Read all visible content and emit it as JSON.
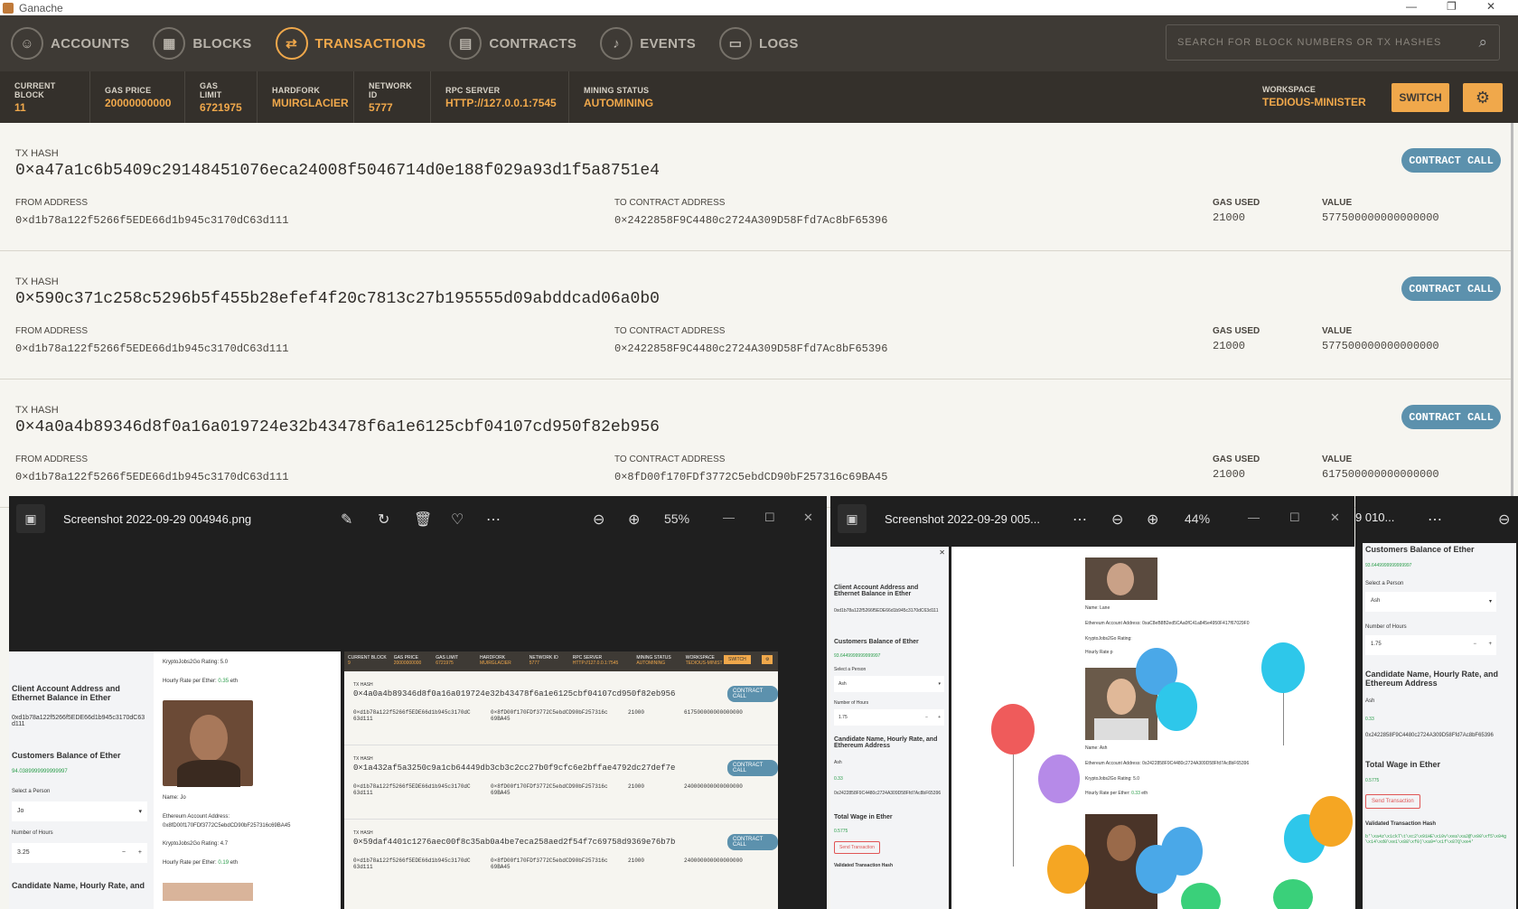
{
  "window": {
    "title": "Ganache",
    "minimize": "—",
    "maximize": "❐",
    "close": "✕"
  },
  "nav": {
    "accounts": "ACCOUNTS",
    "blocks": "BLOCKS",
    "transactions": "TRANSACTIONS",
    "contracts": "CONTRACTS",
    "events": "EVENTS",
    "logs": "LOGS",
    "search_placeholder": "SEARCH FOR BLOCK NUMBERS OR TX HASHES",
    "icons": [
      "person-icon",
      "grid-icon",
      "swap-arrows-icon",
      "document-icon",
      "bell-icon",
      "terminal-icon",
      "search-icon"
    ]
  },
  "stats": [
    {
      "label": "CURRENT BLOCK",
      "value": "11"
    },
    {
      "label": "GAS PRICE",
      "value": "20000000000"
    },
    {
      "label": "GAS LIMIT",
      "value": "6721975"
    },
    {
      "label": "HARDFORK",
      "value": "MUIRGLACIER"
    },
    {
      "label": "NETWORK ID",
      "value": "5777"
    },
    {
      "label": "RPC SERVER",
      "value": "HTTP://127.0.0.1:7545"
    },
    {
      "label": "MINING STATUS",
      "value": "AUTOMINING"
    }
  ],
  "workspace": {
    "label": "WORKSPACE",
    "value": "TEDIOUS-MINISTER",
    "switch": "SWITCH"
  },
  "labels": {
    "tx_hash": "TX HASH",
    "from": "FROM ADDRESS",
    "to": "TO CONTRACT ADDRESS",
    "gas": "GAS USED",
    "value": "VALUE",
    "call": "CONTRACT CALL"
  },
  "transactions": [
    {
      "hash": "0×a47a1c6b5409c29148451076eca24008f5046714d0e188f029a93d1f5a8751e4",
      "from": "0×d1b78a122f5266f5EDE66d1b945c3170dC63d111",
      "to": "0×2422858F9C4480c2724A309D58Ffd7Ac8bF65396",
      "gas": "21000",
      "value": "577500000000000000"
    },
    {
      "hash": "0×590c371c258c5296b5f455b28efef4f20c7813c27b195555d09abddcad06a0b0",
      "from": "0×d1b78a122f5266f5EDE66d1b945c3170dC63d111",
      "to": "0×2422858F9C4480c2724A309D58Ffd7Ac8bF65396",
      "gas": "21000",
      "value": "577500000000000000"
    },
    {
      "hash": "0×4a0a4b89346d8f0a16a019724e32b43478f6a1e6125cbf04107cd950f82eb956",
      "from": "0×d1b78a122f5266f5EDE66d1b945c3170dC63d111",
      "to": "0×8fD00f170FDf3772C5ebdCD90bF257316c69BA45",
      "gas": "21000",
      "value": "617500000000000000"
    }
  ],
  "viewer1": {
    "title": "Screenshot 2022-09-29 004946.png",
    "zoom": "55%",
    "left": {
      "heading1": "Client Account Address and Ethernet Balance in Ether",
      "addr": "0xd1b78a122f5266f5EDE66d1b945c3170dC63d111",
      "heading2": "Customers Balance of Ether",
      "balance": "94.0389999999999997",
      "select_label": "Select a Person",
      "select_value": "Jo",
      "hours_label": "Number of Hours",
      "hours_value": "3.25",
      "heading3": "Candidate Name, Hourly Rate, and"
    },
    "mid": {
      "rating1": "KryptoJobs2Go Rating: 5.0",
      "rate1": "Hourly Rate per Ether:",
      "rate1v": "0.35",
      "eth": "eth",
      "name": "Name: Jo",
      "acct": "Ethereum Account Address:",
      "acctv": "0x8fD00f170FDf3772C5ebdCD90bF257316c69BA45",
      "rating2": "KryptoJobs2Go Rating: 4.7",
      "rate2": "Hourly Rate per Ether:",
      "rate2v": "0.19"
    },
    "mini": {
      "stats": [
        {
          "l": "CURRENT BLOCK",
          "v": "9"
        },
        {
          "l": "GAS PRICE",
          "v": "20000000000"
        },
        {
          "l": "GAS LIMIT",
          "v": "6721975"
        },
        {
          "l": "HARDFORK",
          "v": "MUIRGLACIER"
        },
        {
          "l": "NETWORK ID",
          "v": "5777"
        },
        {
          "l": "RPC SERVER",
          "v": "HTTP://127.0.0.1:7545"
        },
        {
          "l": "MINING STATUS",
          "v": "AUTOMINING"
        },
        {
          "l": "WORKSPACE",
          "v": "TEDIOUS-MINIST"
        }
      ],
      "switch": "SWITCH",
      "txs": [
        {
          "hash": "0×4a0a4b89346d8f0a16a019724e32b43478f6a1e6125cbf04107cd950f82eb956",
          "from": "0×d1b78a122f5266f5EDE66d1b945c3170dC 63d111",
          "to": "0×8fD00f170FDf3772C5ebdCD90bF257316c 69BA45",
          "gas": "21000",
          "value": "617500000000000000"
        },
        {
          "hash": "0×1a432af5a3250c9a1cb64449db3cb3c2cc27b0f9cfc6e2bffae4792dc27def7e",
          "from": "0×d1b78a122f5266f5EDE66d1b945c3170dC 63d111",
          "to": "0×8fD00f170FDf3772C5ebdCD90bF257316c 69BA45",
          "gas": "21000",
          "value": "240000000000000000"
        },
        {
          "hash": "0×59daf4401c1276aec00f8c35ab0a4be7eca258aed2f54f7c69758d9369e76b7b",
          "from": "0×d1b78a122f5266f5EDE66d1b945c3170dC 63d111",
          "to": "0×8fD00f170FDf3772C5ebdCD90bF257316c 69BA45",
          "gas": "21000",
          "value": "240000000000000000"
        }
      ]
    }
  },
  "viewer2": {
    "title": "Screenshot 2022-09-29 005...",
    "zoom": "44%",
    "left": {
      "heading1": "Client Account Address and Ethernet Balance in Ether",
      "addr": "0xd1b78a122f5266f5EDE66d1b945c3170dC63d111",
      "heading2": "Customers Balance of Ether",
      "balance": "93.6449999999999997",
      "select_label": "Select a Person",
      "select_value": "Ash",
      "hours_label": "Number of Hours",
      "hours_value": "1.75",
      "heading3": "Candidate Name, Hourly Rate, and Ethereum Address",
      "name": "Ash",
      "rate": "0.33",
      "addr2": "0x2422858F9C4480c2724A309D58Ffd7Ac8bF65396",
      "heading4": "Total Wage in Ether",
      "wage": "0.5775",
      "send": "Send Transaction",
      "heading5": "Validated Transaction Hash"
    },
    "mid": {
      "name1": "Name: Lane",
      "acct1": "Ethereum Account Address: 0xaC8eB8B2ed5CAa0fC41a845e4950F417f67029F0",
      "rating1": "KryptoJobs2Go Rating:",
      "rate1": "Hourly Rate p",
      "name2": "Name: Ash",
      "acct2": "Ethereum Account Address: 0x2422858F9C4480c2724A309D58Ffd7Ac8bF65396",
      "rating2": "KryptoJobs2Go Rating: 5.0",
      "rate2": "Hourly Rate per Ether:",
      "rate2v": "0.33",
      "eth": "eth"
    }
  },
  "viewer3": {
    "title": "9 010...",
    "balance_heading": "Customers Balance of Ether",
    "balance": "93.6449999999999997",
    "select_label": "Select a Person",
    "select_value": "Ash",
    "hours_label": "Number of Hours",
    "hours_value": "1.75",
    "heading3": "Candidate Name, Hourly Rate, and Ethereum Address",
    "name": "Ash",
    "rate": "0.33",
    "addr": "0x2422858F9C4480c2724A309D58Ffd7Ac8bF65396",
    "heading4": "Total Wage in Ether",
    "wage": "0.5775",
    "send": "Send Transaction",
    "heading5": "Validated Transaction Hash",
    "hash": "b'\\xa4z\\x1ckT\\t\\xc2\\x91HE\\x10v\\xea\\xa2@\\x00\\xf5\\x04g\\x14\\xd0\\xe1\\x88\\xf0)\\xa9=\\x1f\\x87Q\\xe4'"
  }
}
